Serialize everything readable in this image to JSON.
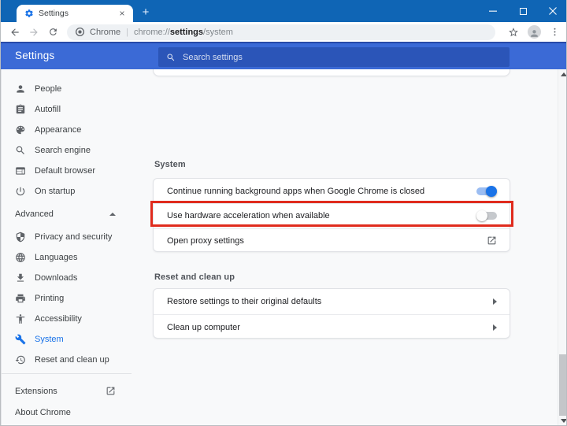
{
  "browser": {
    "tab_title": "Settings",
    "new_tab_glyph": "+",
    "tab_close_glyph": "×",
    "address_bar": {
      "site_label": "Chrome",
      "separator": "|",
      "url_scheme": "chrome://",
      "url_host_bold": "settings",
      "url_path": "/system"
    }
  },
  "settings_header": {
    "title": "Settings",
    "search_placeholder": "Search settings"
  },
  "sidebar": {
    "basic_items": [
      {
        "label": "People",
        "icon": "person-icon"
      },
      {
        "label": "Autofill",
        "icon": "autofill-icon"
      },
      {
        "label": "Appearance",
        "icon": "palette-icon"
      },
      {
        "label": "Search engine",
        "icon": "search-icon"
      },
      {
        "label": "Default browser",
        "icon": "browser-window-icon"
      },
      {
        "label": "On startup",
        "icon": "power-icon"
      }
    ],
    "advanced_label": "Advanced",
    "advanced_items": [
      {
        "label": "Privacy and security",
        "icon": "shield-icon"
      },
      {
        "label": "Languages",
        "icon": "globe-icon"
      },
      {
        "label": "Downloads",
        "icon": "download-icon"
      },
      {
        "label": "Printing",
        "icon": "printer-icon"
      },
      {
        "label": "Accessibility",
        "icon": "accessibility-icon"
      },
      {
        "label": "System",
        "icon": "wrench-icon",
        "selected": true
      },
      {
        "label": "Reset and clean up",
        "icon": "restore-icon"
      }
    ],
    "footer_items": [
      {
        "label": "Extensions",
        "icon": "launch-icon"
      },
      {
        "label": "About Chrome"
      }
    ]
  },
  "content": {
    "sections": [
      {
        "heading": "System",
        "rows": [
          {
            "label": "Continue running background apps when Google Chrome is closed",
            "control": "toggle",
            "state": "on"
          },
          {
            "label": "Use hardware acceleration when available",
            "control": "toggle",
            "state": "off",
            "highlighted": true
          },
          {
            "label": "Open proxy settings",
            "control": "external-link"
          }
        ]
      },
      {
        "heading": "Reset and clean up",
        "rows": [
          {
            "label": "Restore settings to their original defaults",
            "control": "subpage-arrow"
          },
          {
            "label": "Clean up computer",
            "control": "subpage-arrow"
          }
        ]
      }
    ],
    "annotation": {
      "type": "highlight-box",
      "color": "#e02b1d",
      "target": "Use hardware acceleration when available"
    }
  },
  "colors": {
    "titlebar_blue": "#0f65b5",
    "header_blue": "#3b6ad6",
    "search_field_blue": "#2b55b8",
    "accent_blue": "#1a73e8",
    "toggle_on_track": "#9bbdf2",
    "toggle_off_track": "#c6c9cd",
    "highlight_red": "#e02b1d"
  }
}
